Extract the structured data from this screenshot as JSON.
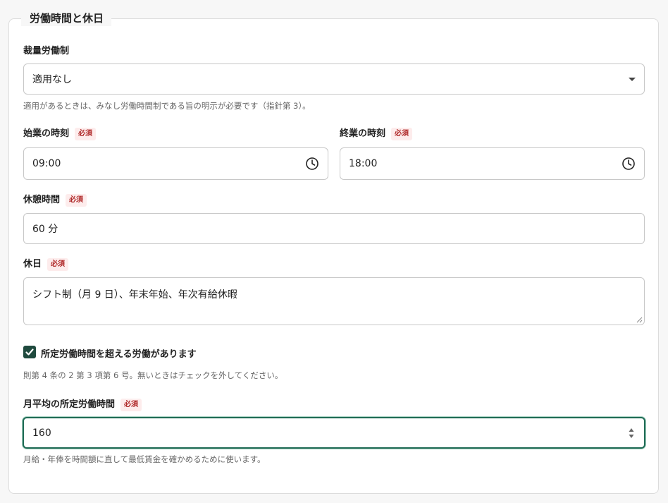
{
  "section": {
    "title": "労働時間と休日"
  },
  "discretionary": {
    "label": "裁量労働制",
    "value": "適用なし",
    "hint": "適用があるときは、みなし労働時間制である旨の明示が必要です（指針第 3）。"
  },
  "required_badge": "必須",
  "start_time": {
    "label": "始業の時刻",
    "value": "09:00"
  },
  "end_time": {
    "label": "終業の時刻",
    "value": "18:00"
  },
  "break_time": {
    "label": "休憩時間",
    "value": "60 分"
  },
  "holidays": {
    "label": "休日",
    "value": "シフト制（月 9 日）、年末年始、年次有給休暇"
  },
  "overtime": {
    "checked": true,
    "label": "所定労働時間を超える労働があります",
    "hint": "則第 4 条の 2 第 3 項第 6 号。無いときはチェックを外してください。"
  },
  "monthly_hours": {
    "label": "月平均の所定労働時間",
    "value": "160",
    "hint": "月給・年俸を時間額に直して最低賃金を確かめるために使います。"
  },
  "icons": {
    "select": "chevron-down-icon",
    "time": "clock-icon",
    "check": "checkmark-icon",
    "spin": "spinner-arrows-icon",
    "resize": "resize-handle-icon"
  },
  "colors": {
    "accent": "#1f4a3e",
    "focus": "#1f6b55",
    "required_text": "#b02a2a",
    "required_bg": "#fdecec"
  }
}
